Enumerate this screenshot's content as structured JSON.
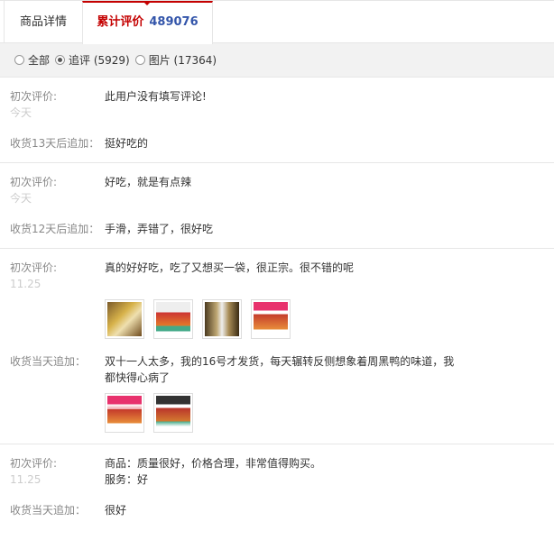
{
  "tabs": {
    "detail_label": "商品详情",
    "reviews_label": "累计评价",
    "reviews_count": "489076"
  },
  "filters": {
    "all": "全部",
    "followup": "追评 (5929)",
    "pictures": "图片 (17364)",
    "selected": "追评"
  },
  "reviews": [
    {
      "first_label": "初次评价:",
      "date": "今天",
      "first_text": "此用户没有填写评论!",
      "followup_label": "收货13天后追加：",
      "followup_text": "挺好吃的"
    },
    {
      "first_label": "初次评价:",
      "date": "今天",
      "first_text": "好吃，就是有点辣",
      "followup_label": "收货12天后追加：",
      "followup_text": "手滑，弄错了，很好吃"
    },
    {
      "first_label": "初次评价:",
      "date": "11.25",
      "first_text": "真的好好吃，吃了又想买一袋，很正宗。很不错的呢",
      "followup_label": "收货当天追加：",
      "followup_text": "双十一人太多，我的16号才发货，每天辗转反侧想象着周黑鸭的味道，我都快得心病了"
    },
    {
      "first_label": "初次评价:",
      "date": "11.25",
      "first_text": "商品：质量很好，价格合理，非常值得购买。",
      "first_text_2": "服务：好",
      "followup_label": "收货当天追加：",
      "followup_text": "很好"
    }
  ]
}
